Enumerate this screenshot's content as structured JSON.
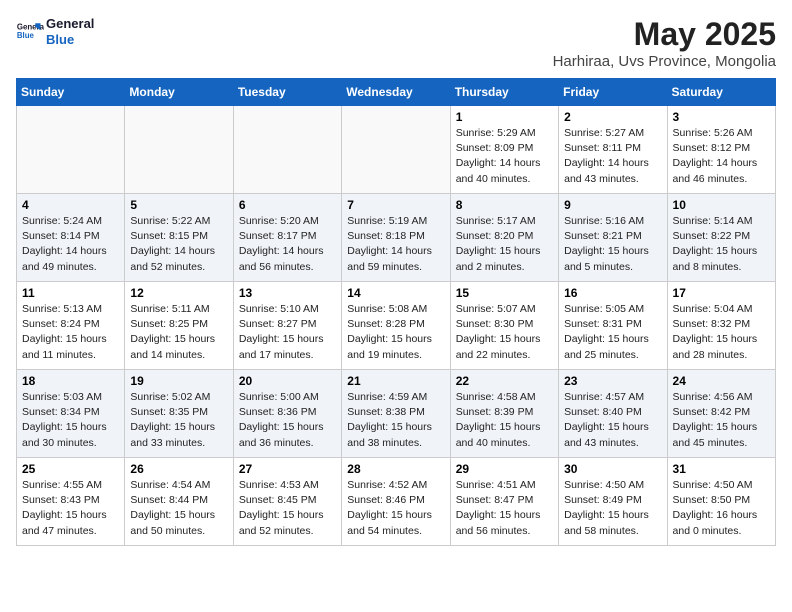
{
  "logo": {
    "line1": "General",
    "line2": "Blue"
  },
  "title": "May 2025",
  "subtitle": "Harhiraa, Uvs Province, Mongolia",
  "days_header": [
    "Sunday",
    "Monday",
    "Tuesday",
    "Wednesday",
    "Thursday",
    "Friday",
    "Saturday"
  ],
  "weeks": [
    [
      {
        "day": "",
        "info": ""
      },
      {
        "day": "",
        "info": ""
      },
      {
        "day": "",
        "info": ""
      },
      {
        "day": "",
        "info": ""
      },
      {
        "day": "1",
        "info": "Sunrise: 5:29 AM\nSunset: 8:09 PM\nDaylight: 14 hours\nand 40 minutes."
      },
      {
        "day": "2",
        "info": "Sunrise: 5:27 AM\nSunset: 8:11 PM\nDaylight: 14 hours\nand 43 minutes."
      },
      {
        "day": "3",
        "info": "Sunrise: 5:26 AM\nSunset: 8:12 PM\nDaylight: 14 hours\nand 46 minutes."
      }
    ],
    [
      {
        "day": "4",
        "info": "Sunrise: 5:24 AM\nSunset: 8:14 PM\nDaylight: 14 hours\nand 49 minutes."
      },
      {
        "day": "5",
        "info": "Sunrise: 5:22 AM\nSunset: 8:15 PM\nDaylight: 14 hours\nand 52 minutes."
      },
      {
        "day": "6",
        "info": "Sunrise: 5:20 AM\nSunset: 8:17 PM\nDaylight: 14 hours\nand 56 minutes."
      },
      {
        "day": "7",
        "info": "Sunrise: 5:19 AM\nSunset: 8:18 PM\nDaylight: 14 hours\nand 59 minutes."
      },
      {
        "day": "8",
        "info": "Sunrise: 5:17 AM\nSunset: 8:20 PM\nDaylight: 15 hours\nand 2 minutes."
      },
      {
        "day": "9",
        "info": "Sunrise: 5:16 AM\nSunset: 8:21 PM\nDaylight: 15 hours\nand 5 minutes."
      },
      {
        "day": "10",
        "info": "Sunrise: 5:14 AM\nSunset: 8:22 PM\nDaylight: 15 hours\nand 8 minutes."
      }
    ],
    [
      {
        "day": "11",
        "info": "Sunrise: 5:13 AM\nSunset: 8:24 PM\nDaylight: 15 hours\nand 11 minutes."
      },
      {
        "day": "12",
        "info": "Sunrise: 5:11 AM\nSunset: 8:25 PM\nDaylight: 15 hours\nand 14 minutes."
      },
      {
        "day": "13",
        "info": "Sunrise: 5:10 AM\nSunset: 8:27 PM\nDaylight: 15 hours\nand 17 minutes."
      },
      {
        "day": "14",
        "info": "Sunrise: 5:08 AM\nSunset: 8:28 PM\nDaylight: 15 hours\nand 19 minutes."
      },
      {
        "day": "15",
        "info": "Sunrise: 5:07 AM\nSunset: 8:30 PM\nDaylight: 15 hours\nand 22 minutes."
      },
      {
        "day": "16",
        "info": "Sunrise: 5:05 AM\nSunset: 8:31 PM\nDaylight: 15 hours\nand 25 minutes."
      },
      {
        "day": "17",
        "info": "Sunrise: 5:04 AM\nSunset: 8:32 PM\nDaylight: 15 hours\nand 28 minutes."
      }
    ],
    [
      {
        "day": "18",
        "info": "Sunrise: 5:03 AM\nSunset: 8:34 PM\nDaylight: 15 hours\nand 30 minutes."
      },
      {
        "day": "19",
        "info": "Sunrise: 5:02 AM\nSunset: 8:35 PM\nDaylight: 15 hours\nand 33 minutes."
      },
      {
        "day": "20",
        "info": "Sunrise: 5:00 AM\nSunset: 8:36 PM\nDaylight: 15 hours\nand 36 minutes."
      },
      {
        "day": "21",
        "info": "Sunrise: 4:59 AM\nSunset: 8:38 PM\nDaylight: 15 hours\nand 38 minutes."
      },
      {
        "day": "22",
        "info": "Sunrise: 4:58 AM\nSunset: 8:39 PM\nDaylight: 15 hours\nand 40 minutes."
      },
      {
        "day": "23",
        "info": "Sunrise: 4:57 AM\nSunset: 8:40 PM\nDaylight: 15 hours\nand 43 minutes."
      },
      {
        "day": "24",
        "info": "Sunrise: 4:56 AM\nSunset: 8:42 PM\nDaylight: 15 hours\nand 45 minutes."
      }
    ],
    [
      {
        "day": "25",
        "info": "Sunrise: 4:55 AM\nSunset: 8:43 PM\nDaylight: 15 hours\nand 47 minutes."
      },
      {
        "day": "26",
        "info": "Sunrise: 4:54 AM\nSunset: 8:44 PM\nDaylight: 15 hours\nand 50 minutes."
      },
      {
        "day": "27",
        "info": "Sunrise: 4:53 AM\nSunset: 8:45 PM\nDaylight: 15 hours\nand 52 minutes."
      },
      {
        "day": "28",
        "info": "Sunrise: 4:52 AM\nSunset: 8:46 PM\nDaylight: 15 hours\nand 54 minutes."
      },
      {
        "day": "29",
        "info": "Sunrise: 4:51 AM\nSunset: 8:47 PM\nDaylight: 15 hours\nand 56 minutes."
      },
      {
        "day": "30",
        "info": "Sunrise: 4:50 AM\nSunset: 8:49 PM\nDaylight: 15 hours\nand 58 minutes."
      },
      {
        "day": "31",
        "info": "Sunrise: 4:50 AM\nSunset: 8:50 PM\nDaylight: 16 hours\nand 0 minutes."
      }
    ]
  ]
}
